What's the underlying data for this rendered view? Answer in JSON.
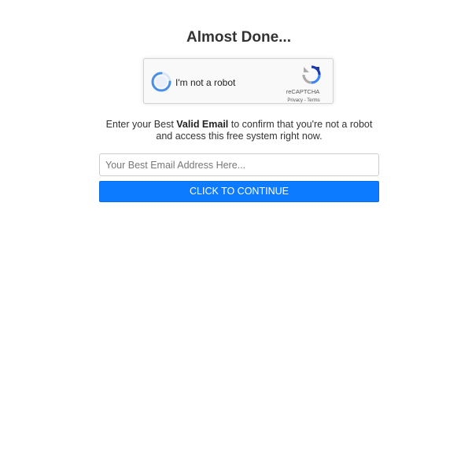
{
  "heading": "Almost Done...",
  "recaptcha": {
    "checkbox_label": "I'm not a robot",
    "brand": "reCAPTCHA",
    "privacy_link": "Privacy",
    "separator": " - ",
    "terms_link": "Terms"
  },
  "message": {
    "prefix": "Enter your Best ",
    "emphasis": "Valid Email",
    "suffix": " to confirm that you're not a robot and access this free system right now."
  },
  "email_input": {
    "placeholder": "Your Best Email Address Here...",
    "value": ""
  },
  "continue_button": {
    "label": "CLICK TO CONTINUE"
  },
  "colors": {
    "button_background": "#0d7bff",
    "button_text": "#ffffff",
    "heading_text": "#333333",
    "recaptcha_spinner": "#4a90e2"
  },
  "icons": {
    "recaptcha_status": "loading-spinner-icon",
    "recaptcha_logo": "recaptcha-logo-icon"
  }
}
